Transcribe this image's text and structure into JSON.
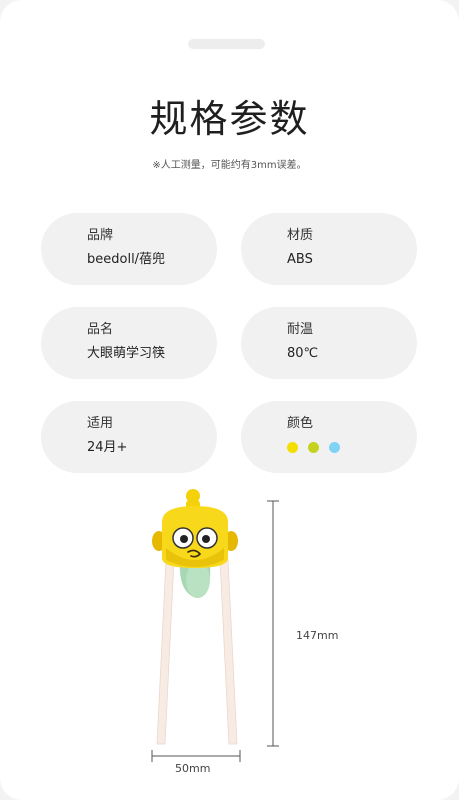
{
  "page": {
    "title": "规格参数",
    "note": "※人工测量，可能约有3mm误差。"
  },
  "specs": [
    {
      "label": "品牌",
      "value": "beedoll/蓓兜"
    },
    {
      "label": "材质",
      "value": "ABS"
    },
    {
      "label": "品名",
      "value": "大眼萌学习筷"
    },
    {
      "label": "耐温",
      "value": "80℃"
    },
    {
      "label": "适用",
      "value": "24月+"
    },
    {
      "label": "颜色",
      "value": ""
    }
  ],
  "colors": [
    "#f4de00",
    "#c6d31c",
    "#7fd3f5"
  ],
  "dimensions": {
    "height": "147mm",
    "width": "50mm"
  }
}
